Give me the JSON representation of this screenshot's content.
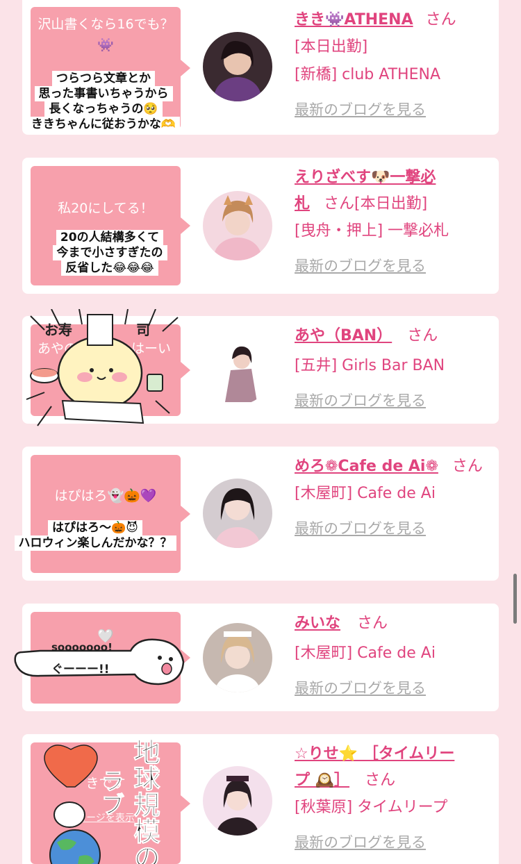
{
  "cards": [
    {
      "bubble_title": "沢山書くなら16でも？👾",
      "sticker_lines": [
        "つらつら文章とか",
        "思った事書いちゃうから",
        "長くなっちゃうの🥺",
        "ききちゃんに従おうかな🫶"
      ],
      "name": "きき👾ATHENA",
      "san": "さん",
      "status": "[本日出勤]",
      "area_shop": "[新橋] club ATHENA",
      "blog_link": "最新のブログを見る",
      "avatar_color": "#6b4a7a"
    },
    {
      "bubble_title": "私20にしてる！",
      "sticker_lines": [
        "20の人結構多くて",
        "今まで小さすぎたの",
        "反省した😂😂😂"
      ],
      "name_part1": "えりざべす🐶一撃必",
      "name_part2": "札",
      "san": "さん",
      "status": "[本日出勤]",
      "area_shop": "[曳舟・押上] 一撃必札",
      "blog_link": "最新のブログを見る",
      "avatar_color": "#e8b8c8"
    },
    {
      "bubble_title_partial": "あやの",
      "bubble_title_right": "はーい",
      "sticker_label_1": "お寿",
      "sticker_label_2": "司",
      "name": "あや（BAN）",
      "san": "さん",
      "area_shop": "[五井] Girls Bar BAN",
      "blog_link": "最新のブログを見る",
      "avatar_color": "#c8b4b8"
    },
    {
      "bubble_title": "はぴはろ👻🎃💜",
      "sticker_lines": [
        "はぴはろ〜🎃😈",
        "ハロウィン楽しんだかな？？"
      ],
      "name": "めろ❁Cafe de Ai❁",
      "san": "さん",
      "area_shop": "[木屋町] Cafe de Ai",
      "blog_link": "最新のブログを見る",
      "avatar_color": "#d8c0c8"
    },
    {
      "bubble_heart": "🤍",
      "sticker_top": "sooooooo!",
      "sticker_bottom": "ぐーーー!!",
      "name": "みいな",
      "san": "さん",
      "area_shop": "[木屋町] Cafe de Ai",
      "blog_link": "最新のブログを見る",
      "avatar_color": "#b8a8a4"
    },
    {
      "sticker_vertical_1": "地球規模の",
      "sticker_vertical_2": "ラブ",
      "bubble_partial": "きです",
      "bubble_partial_link": "セージを表示",
      "name_part1": "☆りせ⭐ ［タイムリー",
      "name_part2": "プ 🕰️］",
      "san": "さん",
      "area_shop": "[秋葉原] タイムリープ",
      "blog_link": "最新のブログを見る",
      "avatar_color": "#e4c4d4"
    }
  ],
  "colors": {
    "accent": "#e0447e",
    "bubble": "#f7a0ac",
    "background": "#fbe3e8",
    "link_gray": "#a9a9a9"
  }
}
